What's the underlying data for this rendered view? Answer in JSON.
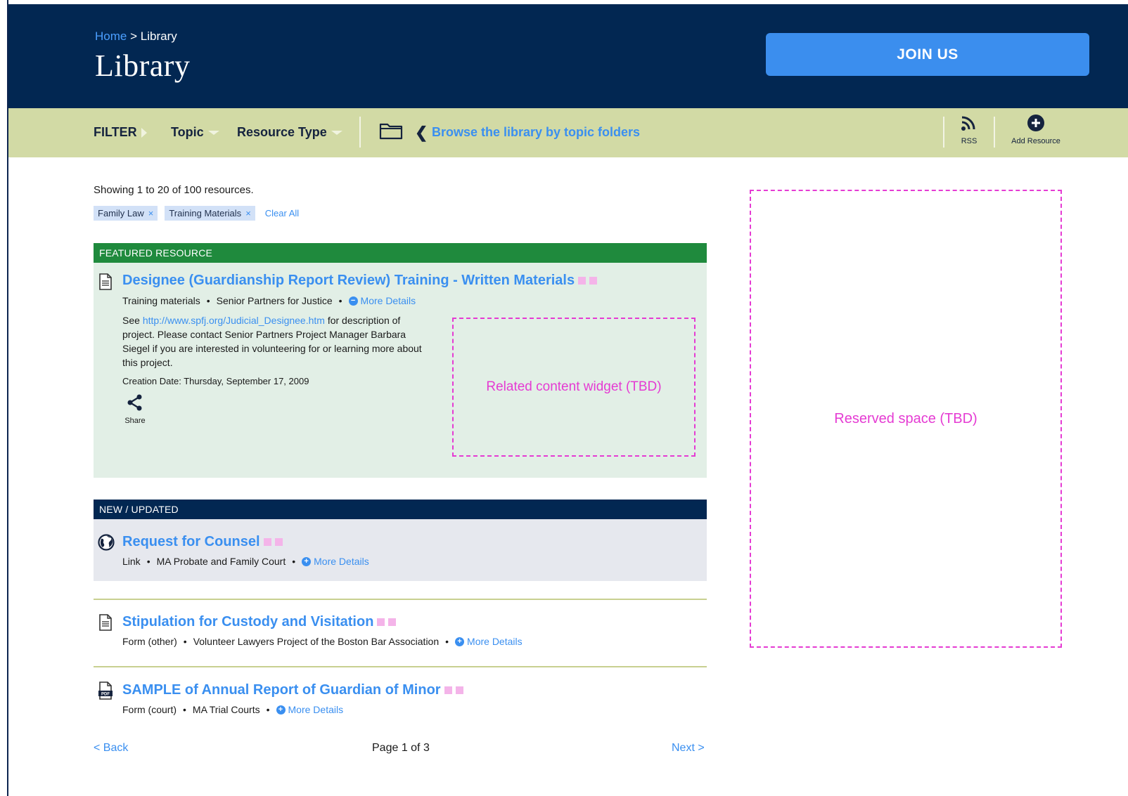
{
  "header": {
    "breadcrumb_home": "Home",
    "breadcrumb_sep": ">",
    "breadcrumb_current": "Library",
    "title": "Library",
    "join_label": "JOIN US"
  },
  "filterbar": {
    "filter_label": "FILTER",
    "topic_label": "Topic",
    "resource_type_label": "Resource Type",
    "browse_label": "Browse the library by topic folders",
    "rss_label": "RSS",
    "add_label": "Add Resource"
  },
  "results": {
    "showing": "Showing 1 to 20 of 100 resources.",
    "chips": [
      {
        "label": "Family Law",
        "remove": "×"
      },
      {
        "label": "Training Materials",
        "remove": "×"
      }
    ],
    "clear_all": "Clear All"
  },
  "featured": {
    "section_label": "FEATURED RESOURCE",
    "title": "Designee (Guardianship Report Review) Training - Written Materials",
    "type": "Training materials",
    "source": "Senior Partners for Justice",
    "more_details": "More Details",
    "desc_pre": "See",
    "desc_link": "http://www.spfj.org/Judicial_Designee.htm",
    "desc_post": "for description of project. Please contact Senior Partners Project Manager Barbara Siegel if you are interested in volunteering for or learning more about this project.",
    "creation": "Creation Date: Thursday, September 17, 2009",
    "share_label": "Share",
    "widget_label": "Related content widget (TBD)"
  },
  "new_updated": {
    "section_label": "NEW / UPDATED",
    "items": [
      {
        "title": "Request for Counsel",
        "type": "Link",
        "source": "MA Probate and Family Court",
        "more": "More Details",
        "icon": "globe-icon"
      },
      {
        "title": "Stipulation for Custody and Visitation",
        "type": "Form (other)",
        "source": "Volunteer Lawyers Project of the Boston Bar Association",
        "more": "More Details",
        "icon": "document-icon"
      },
      {
        "title": "SAMPLE of Annual Report of Guardian of Minor",
        "type": "Form (court)",
        "source": "MA Trial Courts",
        "more": "More Details",
        "icon": "pdf-icon"
      }
    ]
  },
  "pager": {
    "back": "< Back",
    "label": "Page 1 of 3",
    "next": "Next >"
  },
  "reserved_label": "Reserved space (TBD)",
  "colors": {
    "navy": "#022752",
    "accent_blue": "#3b8eee",
    "filter_bg": "#d2daa5",
    "featured_green": "#1f8a3d",
    "placeholder_magenta": "#e53bd3"
  }
}
